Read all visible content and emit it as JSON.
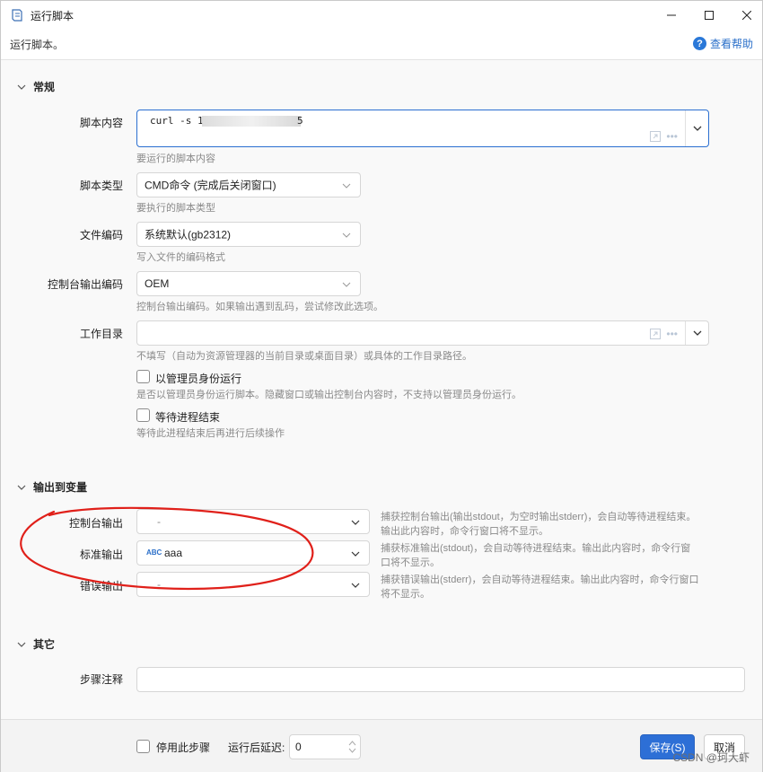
{
  "window": {
    "title": "运行脚本",
    "subtitle": "运行脚本。",
    "help": "查看帮助"
  },
  "general": {
    "section_title": "常规",
    "script_content": {
      "label": "脚本内容",
      "value": "curl -s 1",
      "value_tail": "5",
      "hint": "要运行的脚本内容"
    },
    "script_type": {
      "label": "脚本类型",
      "value": "CMD命令 (完成后关闭窗口)",
      "hint": "要执行的脚本类型"
    },
    "file_encoding": {
      "label": "文件编码",
      "value": "系统默认(gb2312)",
      "hint": "写入文件的编码格式"
    },
    "console_encoding": {
      "label": "控制台输出编码",
      "value": "OEM",
      "hint": "控制台输出编码。如果输出遇到乱码，尝试修改此选项。"
    },
    "work_dir": {
      "label": "工作目录",
      "value": "",
      "hint": "不填写（自动为资源管理器的当前目录或桌面目录）或具体的工作目录路径。"
    },
    "run_as_admin": {
      "label": "以管理员身份运行",
      "hint": "是否以管理员身份运行脚本。隐藏窗口或输出控制台内容时，不支持以管理员身份运行。"
    },
    "wait_process": {
      "label": "等待进程结束",
      "hint": "等待此进程结束后再进行后续操作"
    }
  },
  "output": {
    "section_title": "输出到变量",
    "console_output": {
      "label": "控制台输出",
      "value": "-",
      "note": "捕获控制台输出(输出stdout，为空时输出stderr)，会自动等待进程结束。输出此内容时，命令行窗口将不显示。"
    },
    "stdout": {
      "label": "标准输出",
      "badge": "ABC",
      "value": "aaa",
      "note": "捕获标准输出(stdout)，会自动等待进程结束。输出此内容时，命令行窗口将不显示。"
    },
    "stderr": {
      "label": "错误输出",
      "value": "-",
      "note": "捕获错误输出(stderr)，会自动等待进程结束。输出此内容时，命令行窗口将不显示。"
    }
  },
  "other": {
    "section_title": "其它",
    "step_note": {
      "label": "步骤注释",
      "value": ""
    }
  },
  "footer": {
    "disable_step": "停用此步骤",
    "delay_label": "运行后延迟:",
    "delay_value": "0",
    "save": "保存(S)",
    "cancel": "取消",
    "watermark": "CSDN @珂大虾"
  },
  "colors": {
    "accent": "#2d6fd6",
    "annotation": "#e0201a"
  }
}
